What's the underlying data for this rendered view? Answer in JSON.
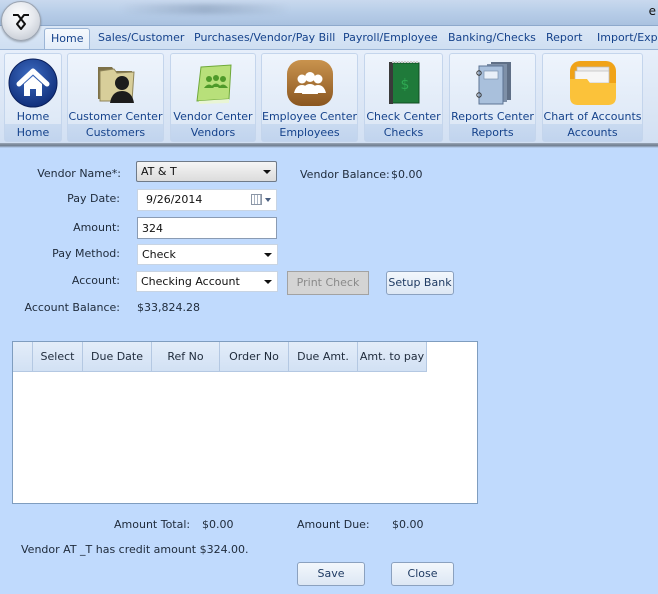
{
  "window": {
    "title_partial": "e"
  },
  "tabs": [
    {
      "label": "Home",
      "active": true
    },
    {
      "label": "Sales/Customer",
      "active": false
    },
    {
      "label": "Purchases/Vendor/Pay Bill",
      "active": false
    },
    {
      "label": "Payroll/Employee",
      "active": false
    },
    {
      "label": "Banking/Checks",
      "active": false
    },
    {
      "label": "Report",
      "active": false
    },
    {
      "label": "Import/Expo",
      "active": false
    }
  ],
  "ribbon": {
    "groups": [
      {
        "button": "Home",
        "group": "Home",
        "icon": "home-icon"
      },
      {
        "button": "Customer Center",
        "group": "Customers",
        "icon": "customer-folder-icon"
      },
      {
        "button": "Vendor Center",
        "group": "Vendors",
        "icon": "vendor-book-icon"
      },
      {
        "button": "Employee Center",
        "group": "Employees",
        "icon": "employees-icon"
      },
      {
        "button": "Check Center",
        "group": "Checks",
        "icon": "checkbook-icon"
      },
      {
        "button": "Reports Center",
        "group": "Reports",
        "icon": "reports-binder-icon"
      },
      {
        "button": "Chart of Accounts",
        "group": "Accounts",
        "icon": "accounts-folder-icon"
      }
    ]
  },
  "form": {
    "vendor_name_label": "Vendor Name*:",
    "vendor_name_value": "AT & T",
    "vendor_balance_label": "Vendor Balance:",
    "vendor_balance_value": "$0.00",
    "pay_date_label": "Pay Date:",
    "pay_date_value": "9/26/2014",
    "amount_label": "Amount:",
    "amount_value": "324",
    "pay_method_label": "Pay Method:",
    "pay_method_value": "Check",
    "account_label": "Account:",
    "account_value": "Checking Account",
    "print_check_label": "Print Check",
    "setup_bank_label": "Setup Bank",
    "account_balance_label": "Account Balance:",
    "account_balance_value": "$33,824.28"
  },
  "grid": {
    "columns": [
      "",
      "Select",
      "Due Date",
      "Ref No",
      "Order No",
      "Due Amt.",
      "Amt. to pay"
    ],
    "rows": []
  },
  "totals": {
    "amount_total_label": "Amount Total:",
    "amount_total_value": "$0.00",
    "amount_due_label": "Amount Due:",
    "amount_due_value": "$0.00"
  },
  "message": "Vendor AT _T has credit amount $324.00.",
  "actions": {
    "save_label": "Save",
    "close_label": "Close"
  }
}
